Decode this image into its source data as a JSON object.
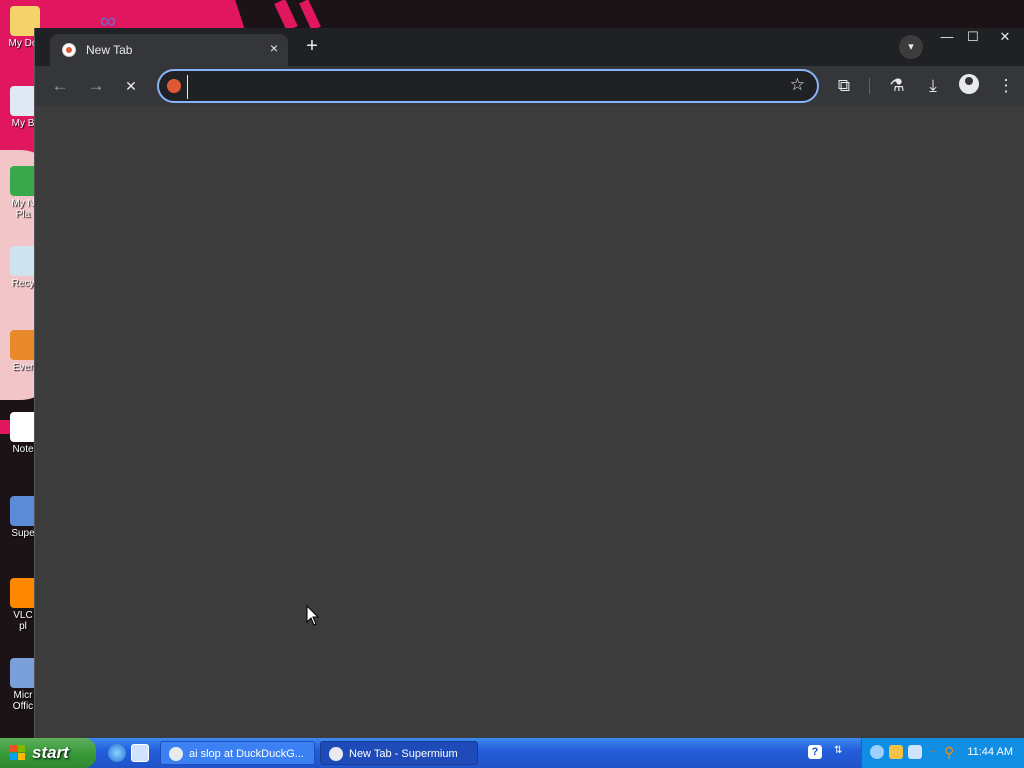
{
  "desktop": {
    "icons": [
      {
        "label": "My Do",
        "icon": "my-documents-icon",
        "color": "#f5d36b"
      },
      {
        "label": "My B",
        "icon": "my-computer-icon",
        "color": "#dfe9f5"
      },
      {
        "label": "My N\nPla",
        "icon": "my-network-icon",
        "color": "#39a84a"
      },
      {
        "label": "Recy",
        "icon": "recycle-bin-icon",
        "color": "#cfe3ef"
      },
      {
        "label": "Ever",
        "icon": "everything-icon",
        "color": "#e8892b"
      },
      {
        "label": "Note",
        "icon": "notepad-icon",
        "color": "#ffffff"
      },
      {
        "label": "Supe",
        "icon": "supermium-icon",
        "color": "#5b8bd6"
      },
      {
        "label": "VLC\npl",
        "icon": "vlc-icon",
        "color": "#ff8800"
      },
      {
        "label": "Micr\nOffic",
        "icon": "office-icon",
        "color": "#7a9fd9"
      }
    ]
  },
  "browser": {
    "tab_title": "New Tab",
    "tab_close": "×",
    "new_tab_symbol": "+",
    "window_controls": {
      "minimize": "—",
      "maximize": "☐",
      "close": "✕"
    },
    "toolbar": {
      "back": "←",
      "forward": "→",
      "stop": "✕",
      "bookmark": "☆",
      "extensions": "⧉",
      "labs": "⚗",
      "downloads": "⤓",
      "menu": "⋮"
    },
    "omnibox": {
      "value": "",
      "placeholder": ""
    }
  },
  "taskbar": {
    "start_label": "start",
    "tasks": [
      {
        "label": "ai slop at DuckDuckG...",
        "active": false
      },
      {
        "label": "New Tab - Supermium",
        "active": true
      }
    ],
    "clock": "11:44 AM"
  }
}
